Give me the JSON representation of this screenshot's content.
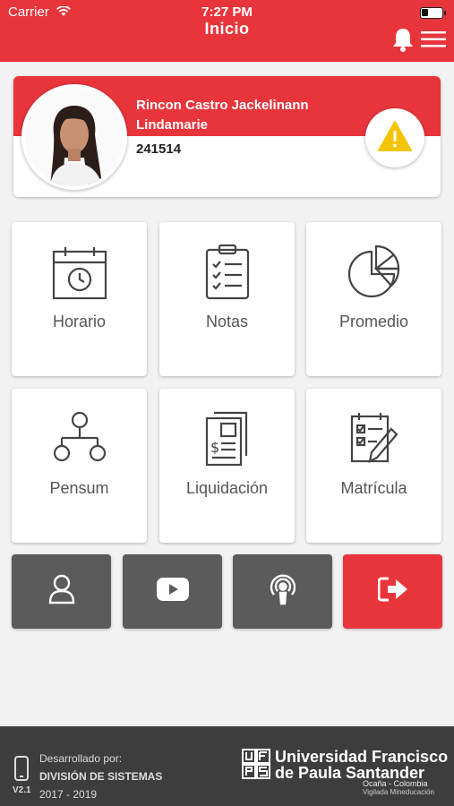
{
  "status_bar": {
    "carrier": "Carrier",
    "time": "7:27 PM",
    "battery_level": 0.3
  },
  "header": {
    "title": "Inicio",
    "icons": [
      "bell-icon",
      "menu-icon"
    ]
  },
  "profile": {
    "name": "Rincon Castro Jackelinann Lindamarie",
    "code": "241514",
    "alert_icon": "warning-icon"
  },
  "tiles": [
    {
      "label": "Horario",
      "icon": "calendar-clock-icon"
    },
    {
      "label": "Notas",
      "icon": "clipboard-checklist-icon"
    },
    {
      "label": "Promedio",
      "icon": "pie-chart-icon"
    },
    {
      "label": "Pensum",
      "icon": "hierarchy-icon"
    },
    {
      "label": "Liquidación",
      "icon": "invoice-icon"
    },
    {
      "label": "Matrícula",
      "icon": "enrollment-form-icon"
    }
  ],
  "actions": [
    {
      "icon": "user-icon"
    },
    {
      "icon": "youtube-icon"
    },
    {
      "icon": "podcast-icon"
    },
    {
      "icon": "logout-icon"
    }
  ],
  "colors": {
    "primary": "#e8353c",
    "dark_button": "#5b5b5b",
    "footer": "#3d3d3d"
  },
  "footer": {
    "developed_by": "Desarrollado por:",
    "division": "DIVISIÓN DE SISTEMAS",
    "years": "2017 - 2019",
    "version": "V2.1",
    "university_line1": "Universidad Francisco",
    "university_line2": "de Paula Santander",
    "location": "Ocaña - Colombia",
    "oversight": "Vigilada Mineducación"
  }
}
